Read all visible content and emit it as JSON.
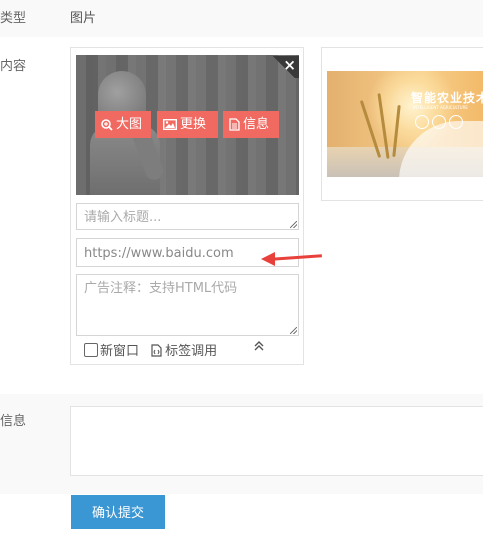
{
  "type_row": {
    "label": "类型",
    "value": "图片"
  },
  "content_row": {
    "label": "内容",
    "image_card": {
      "close_symbol": "×",
      "buttons": [
        {
          "label": "大图",
          "icon": "zoom-icon"
        },
        {
          "label": "更换",
          "icon": "image-icon"
        },
        {
          "label": "信息",
          "icon": "document-icon"
        }
      ],
      "title_placeholder": "请输入标题...",
      "url_value": "https://www.baidu.com",
      "note_placeholder": "广告注释：支持HTML代码",
      "new_window_label": "新窗口",
      "tag_call_label": "标签调用",
      "collapse_symbol": "⌃"
    },
    "ad_preview": {
      "title": "智能农业技术",
      "subtitle": "INTELLIGENT AGRICULTURE"
    }
  },
  "info_row": {
    "label": "信息"
  },
  "submit_label": "确认提交",
  "colors": {
    "accent": "#f06a62",
    "submit": "#3b97d3",
    "arrow": "#e8403b"
  }
}
